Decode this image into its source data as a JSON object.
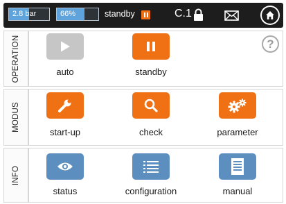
{
  "status_bar": {
    "pressure": {
      "label": "2.8 bar",
      "fill_fraction": 0.5
    },
    "level": {
      "label": "66%",
      "fill_fraction": 0.66
    },
    "mode_label": "standby",
    "access_level": "C.1",
    "icons": [
      "pause-icon",
      "lock-icon",
      "mail-icon",
      "home-icon"
    ]
  },
  "sections": {
    "operation": {
      "title": "OPERATION",
      "help_label": "?",
      "items": [
        {
          "label": "auto",
          "icon": "play-icon",
          "enabled": false
        },
        {
          "label": "standby",
          "icon": "pause-icon",
          "enabled": true
        }
      ]
    },
    "modus": {
      "title": "MODUS",
      "items": [
        {
          "label": "start-up",
          "icon": "wrench-icon"
        },
        {
          "label": "check",
          "icon": "search-icon"
        },
        {
          "label": "parameter",
          "icon": "gears-icon"
        }
      ]
    },
    "info": {
      "title": "INFO",
      "items": [
        {
          "label": "status",
          "icon": "eye-icon"
        },
        {
          "label": "configuration",
          "icon": "list-icon"
        },
        {
          "label": "manual",
          "icon": "document-icon"
        }
      ]
    }
  },
  "colors": {
    "accent_orange": "#f07014",
    "info_blue": "#5c8fbf",
    "disabled_gray": "#c6c6c6",
    "bar_background": "#1d1d1d",
    "gauge_fill": "#5ea3dc"
  }
}
